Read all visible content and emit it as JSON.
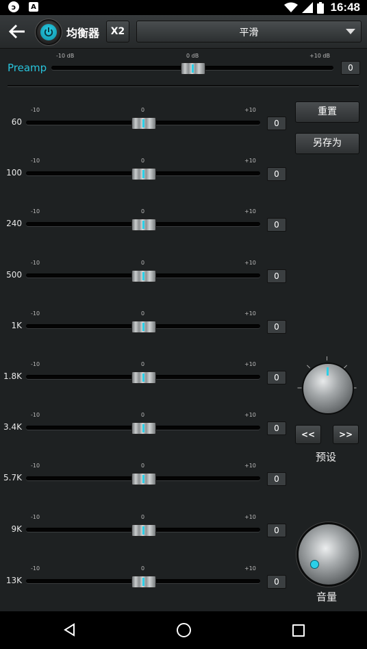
{
  "status_bar": {
    "time": "16:48"
  },
  "header": {
    "title": "均衡器",
    "x2_label": "X2",
    "preset_name": "平滑"
  },
  "preamp": {
    "label": "Preamp",
    "min_label": "-10 dB",
    "mid_label": "0 dB",
    "max_label": "+10 dB",
    "value": "0"
  },
  "band_scale": {
    "min": "-10",
    "mid": "0",
    "max": "+10"
  },
  "bands": [
    {
      "label": "60",
      "value": "0"
    },
    {
      "label": "100",
      "value": "0"
    },
    {
      "label": "240",
      "value": "0"
    },
    {
      "label": "500",
      "value": "0"
    },
    {
      "label": "1K",
      "value": "0"
    },
    {
      "label": "1.8K",
      "value": "0"
    },
    {
      "label": "3.4K",
      "value": "0"
    },
    {
      "label": "5.7K",
      "value": "0"
    },
    {
      "label": "9K",
      "value": "0"
    },
    {
      "label": "13K",
      "value": "0"
    }
  ],
  "side": {
    "reset_label": "重置",
    "save_as_label": "另存为",
    "prev_label": "<<",
    "next_label": ">>",
    "preset_caption": "预设",
    "volume_caption": "音量"
  },
  "colors": {
    "accent": "#28c4dc",
    "background": "#1e2122"
  }
}
